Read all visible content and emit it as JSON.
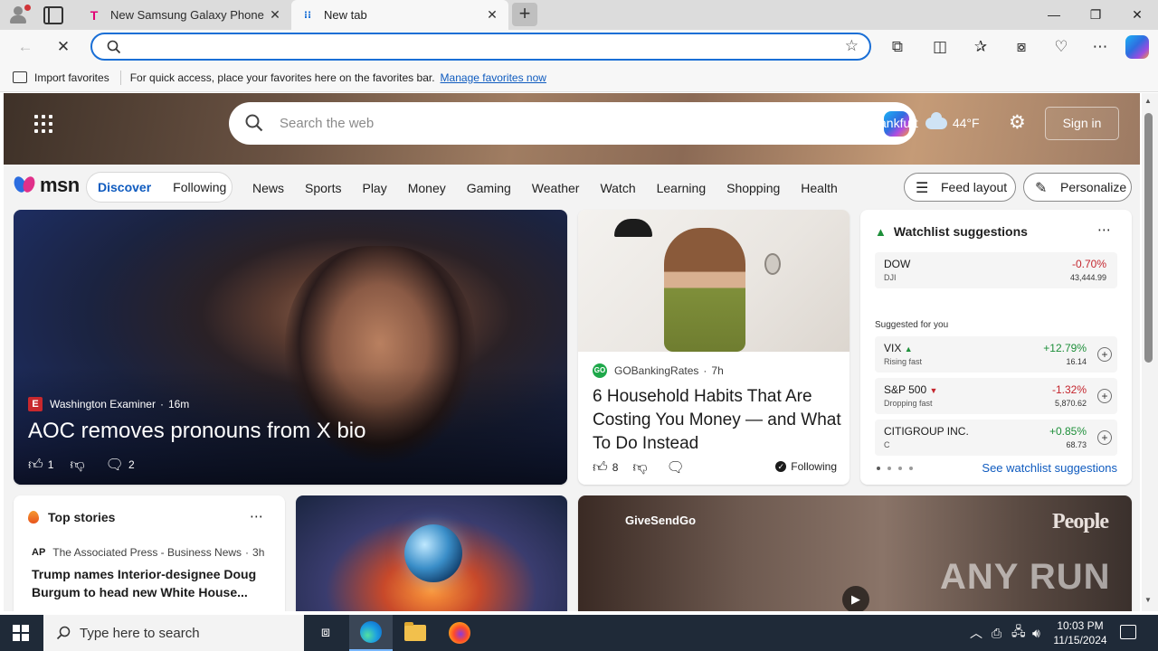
{
  "browser": {
    "tabs": [
      {
        "title": "New Samsung Galaxy Phone Dea",
        "icon": "t-mobile-icon",
        "active": false
      },
      {
        "title": "New tab",
        "icon": "msn-icon",
        "active": true
      }
    ],
    "address": {
      "value": "",
      "placeholder": ""
    },
    "favbar": {
      "import_label": "Import favorites",
      "hint": "For quick access, place your favorites here on the favorites bar.",
      "manage_link": "Manage favorites now"
    }
  },
  "msn": {
    "search_placeholder": "Search the web",
    "weather": {
      "city": "ankfurt",
      "temp": "44°F"
    },
    "sign_in": "Sign in",
    "logo": "msn",
    "feed_tabs": [
      "Discover",
      "Following"
    ],
    "categories": [
      "News",
      "Sports",
      "Play",
      "Money",
      "Gaming",
      "Weather",
      "Watch",
      "Learning",
      "Shopping",
      "Health"
    ],
    "feed_layout": "Feed layout",
    "personalize": "Personalize",
    "hero": {
      "source": "Washington Examiner",
      "age": "16m",
      "title": "AOC removes pronouns from X bio",
      "likes": "1",
      "comments": "2"
    },
    "story2": {
      "source": "GOBankingRates",
      "age": "7h",
      "title": "6 Household Habits That Are Costing You Money — and What To Do Instead",
      "likes": "8",
      "following": "Following"
    },
    "watchlist": {
      "title": "Watchlist suggestions",
      "primary": {
        "symbol": "DOW",
        "sub": "DJI",
        "change": "-0.70%",
        "price": "43,444.99"
      },
      "suggested_label": "Suggested for you",
      "suggested": [
        {
          "symbol": "VIX",
          "sub": "Rising fast",
          "change": "+12.79%",
          "price": "16.14",
          "trend": "up"
        },
        {
          "symbol": "S&P 500",
          "sub": "Dropping fast",
          "change": "-1.32%",
          "price": "5,870.62",
          "trend": "down"
        },
        {
          "symbol": "CITIGROUP INC.",
          "sub": "C",
          "change": "+0.85%",
          "price": "68.73",
          "trend": "up"
        }
      ],
      "see_link": "See watchlist suggestions"
    },
    "top_stories": {
      "title": "Top stories",
      "source": "The Associated Press - Business News",
      "age": "3h",
      "headline": "Trump names Interior-designee Doug Burgum to head new White House..."
    },
    "video": {
      "overlay_text": "GiveSendGo",
      "brand": "People",
      "watermark": "ANY RUN"
    }
  },
  "taskbar": {
    "search_placeholder": "Type here to search",
    "time": "10:03 PM",
    "date": "11/15/2024"
  }
}
